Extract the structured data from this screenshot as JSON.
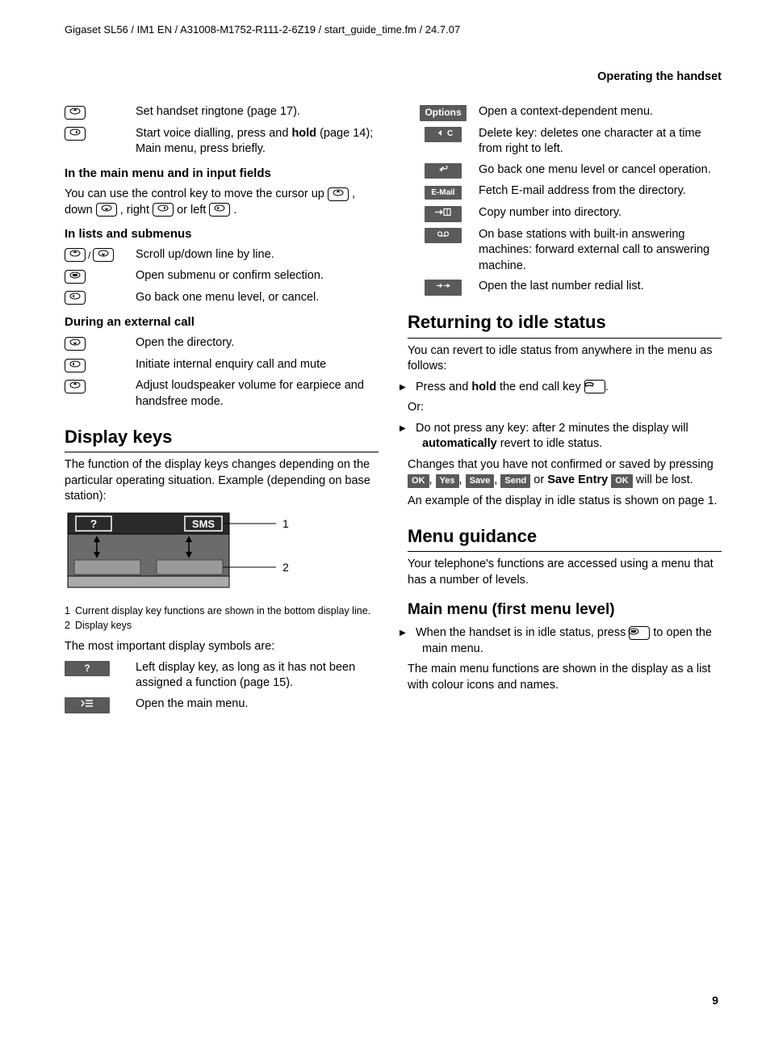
{
  "headerPath": "Gigaset SL56 / IM1 EN / A31008-M1752-R111-2-6Z19 / start_guide_time.fm / 24.7.07",
  "sectionTitle": "Operating the handset",
  "pageNumber": "9",
  "leftCol": {
    "introRows": [
      {
        "desc": "Set handset ringtone (page 17)."
      },
      {
        "desc_pre": "Start voice dialling, press and ",
        "desc_bold": "hold",
        "desc_post": " (page 14);\nMain menu, press briefly."
      }
    ],
    "h3a": "In the main menu and in input fields",
    "pA": "You can use the control key to move the cursor up ",
    "pA_mid1": ", down ",
    "pA_mid2": ", right ",
    "pA_mid3": " or left ",
    "pA_end": ".",
    "h3b": "In lists and submenus",
    "listsRows": [
      {
        "desc": "Scroll up/down line by line."
      },
      {
        "desc": "Open submenu or confirm selection."
      },
      {
        "desc": "Go back one menu level, or cancel."
      }
    ],
    "h3c": "During an external call",
    "callRows": [
      {
        "desc": "Open the directory."
      },
      {
        "desc": "Initiate internal enquiry call and mute"
      },
      {
        "desc": "Adjust loudspeaker volume for earpiece and handsfree mode."
      }
    ],
    "displayKeys": {
      "h2": "Display keys",
      "intro": "The function of the display keys changes depending on the particular operating situation. Example (depending on base station):",
      "diagramSMS": "SMS",
      "diagramQ": "?",
      "callouts": [
        {
          "num": "1",
          "text": "Current display key functions are shown in the bottom display line."
        },
        {
          "num": "2",
          "text": "Display keys"
        }
      ],
      "mostImportant": "The most important display symbols are:",
      "symbolRows": [
        {
          "label": "?",
          "desc": "Left display key, as long as it has not been assigned a function (page 15)."
        },
        {
          "label": "menu",
          "desc": "Open the main menu."
        }
      ]
    }
  },
  "rightCol": {
    "dkRows": [
      {
        "label": "Options",
        "desc": "Open a context-dependent menu."
      },
      {
        "label": "◂C",
        "desc": "Delete key: deletes one character at a time from right to left."
      },
      {
        "label": "↩",
        "desc": "Go back one menu level or cancel operation."
      },
      {
        "label": "E-Mail",
        "desc": "Fetch E-mail address from the directory."
      },
      {
        "label": "→▯",
        "desc": "Copy number into directory."
      },
      {
        "label": "⌀⌀",
        "desc": "On base stations with built-in answering machines: forward external call to answering machine."
      },
      {
        "label": "→→",
        "desc": "Open the last number redial list."
      }
    ],
    "idle": {
      "h2": "Returning to idle status",
      "p1": "You can revert to idle status from anywhere in the menu as follows:",
      "b1_pre": "Press and ",
      "b1_bold": "hold",
      "b1_post": " the end call key ",
      "b1_end": ".",
      "or": "Or:",
      "b2_pre": "Do not press any key: after 2 minutes the display will ",
      "b2_bold": "automatically",
      "b2_post": " revert to idle status.",
      "p2_pre": "Changes that you have not confirmed or saved by pressing ",
      "badges": [
        "OK",
        "Yes",
        "Save",
        "Send"
      ],
      "p2_mid": " or ",
      "p2_bold": "Save Entry",
      "badge2": "OK",
      "p2_post": " will be lost.",
      "p3": "An example of the display in idle status is shown on page 1."
    },
    "menuGuidance": {
      "h2": "Menu guidance",
      "p": "Your telephone's functions are accessed using a menu that has a number of levels."
    },
    "mainMenu": {
      "h2sub": "Main menu (first menu level)",
      "b1_pre": "When the handset is in idle status, press ",
      "b1_post": " to open the main menu.",
      "p": "The main menu functions are shown in the display as a list with colour icons and names."
    }
  }
}
